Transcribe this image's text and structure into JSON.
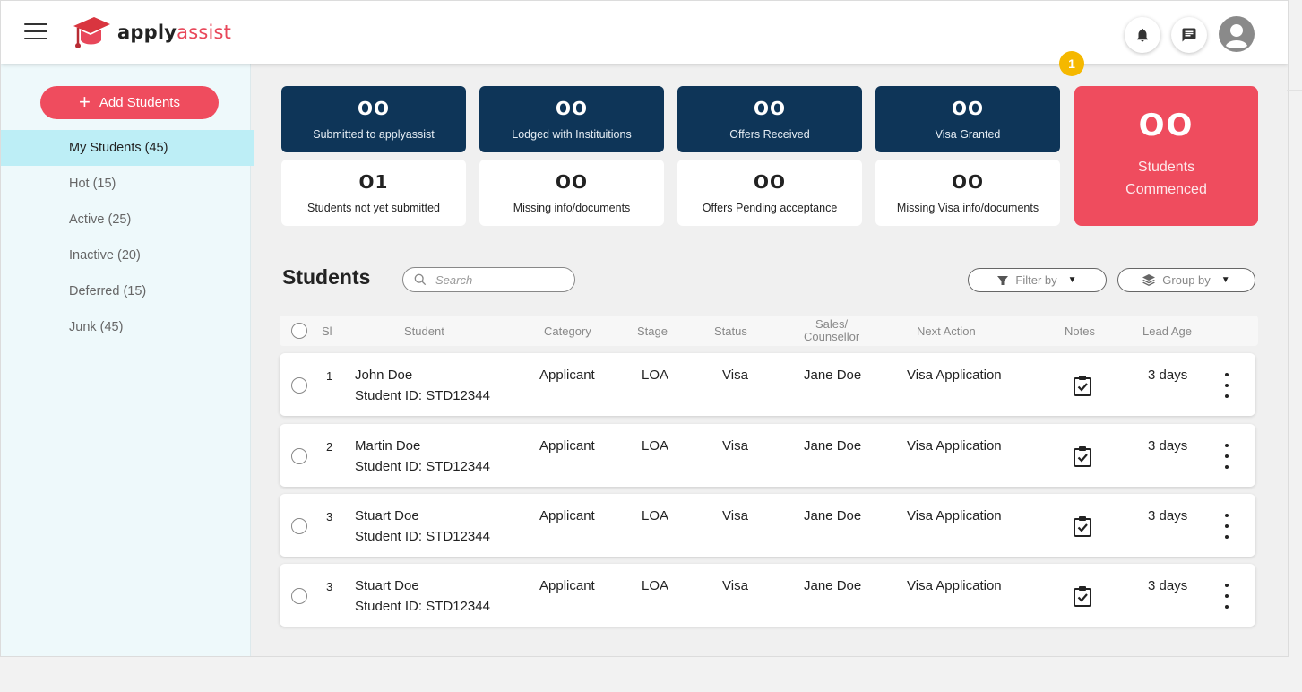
{
  "app": {
    "brand_a": "apply",
    "brand_b": "assist"
  },
  "header": {
    "notification_badge": "1"
  },
  "sidebar": {
    "add_button": "Add Students",
    "items": [
      {
        "label": "My Students (45)",
        "active": true
      },
      {
        "label": "Hot (15)",
        "active": false
      },
      {
        "label": "Active (25)",
        "active": false
      },
      {
        "label": "Inactive (20)",
        "active": false
      },
      {
        "label": "Deferred (15)",
        "active": false
      },
      {
        "label": "Junk (45)",
        "active": false
      }
    ]
  },
  "stats": {
    "dark": [
      {
        "value": "OO",
        "label": "Submitted to applyassist"
      },
      {
        "value": "OO",
        "label": "Lodged with Instituitions"
      },
      {
        "value": "OO",
        "label": "Offers Received"
      },
      {
        "value": "OO",
        "label": "Visa Granted"
      }
    ],
    "light": [
      {
        "value": "O1",
        "label": "Students not yet submitted"
      },
      {
        "value": "OO",
        "label": "Missing info/documents"
      },
      {
        "value": "OO",
        "label": "Offers Pending acceptance"
      },
      {
        "value": "OO",
        "label": "Missing Visa info/documents"
      }
    ],
    "commenced": {
      "value": "OO",
      "label_line1": "Students",
      "label_line2": "Commenced"
    }
  },
  "students": {
    "title": "Students",
    "search_placeholder": "Search",
    "filter_label": "Filter by",
    "group_label": "Group by",
    "columns": {
      "sl": "Sl",
      "student": "Student",
      "category": "Category",
      "stage": "Stage",
      "status": "Status",
      "sales_line1": "Sales/",
      "sales_line2": "Counsellor",
      "next_action": "Next Action",
      "notes": "Notes",
      "lead_age": "Lead Age"
    },
    "rows": [
      {
        "sl": "1",
        "name": "John Doe",
        "id": "Student ID: STD12344",
        "category": "Applicant",
        "stage": "LOA",
        "status": "Visa",
        "counsellor": "Jane Doe",
        "next_action": "Visa Application",
        "lead_age": "3 days"
      },
      {
        "sl": "2",
        "name": "Martin Doe",
        "id": "Student ID: STD12344",
        "category": "Applicant",
        "stage": "LOA",
        "status": "Visa",
        "counsellor": "Jane Doe",
        "next_action": "Visa Application",
        "lead_age": "3 days"
      },
      {
        "sl": "3",
        "name": "Stuart Doe",
        "id": "Student ID: STD12344",
        "category": "Applicant",
        "stage": "LOA",
        "status": "Visa",
        "counsellor": "Jane Doe",
        "next_action": "Visa Application",
        "lead_age": "3 days"
      },
      {
        "sl": "3",
        "name": "Stuart Doe",
        "id": "Student ID: STD12344",
        "category": "Applicant",
        "stage": "LOA",
        "status": "Visa",
        "counsellor": "Jane Doe",
        "next_action": "Visa Application",
        "lead_age": "3 days"
      }
    ]
  },
  "colors": {
    "brand_red": "#ef4c5e",
    "navy": "#0e3558",
    "sidebar_bg": "#eef9fb",
    "active_item": "#bdeef6",
    "badge": "#f5b800"
  }
}
